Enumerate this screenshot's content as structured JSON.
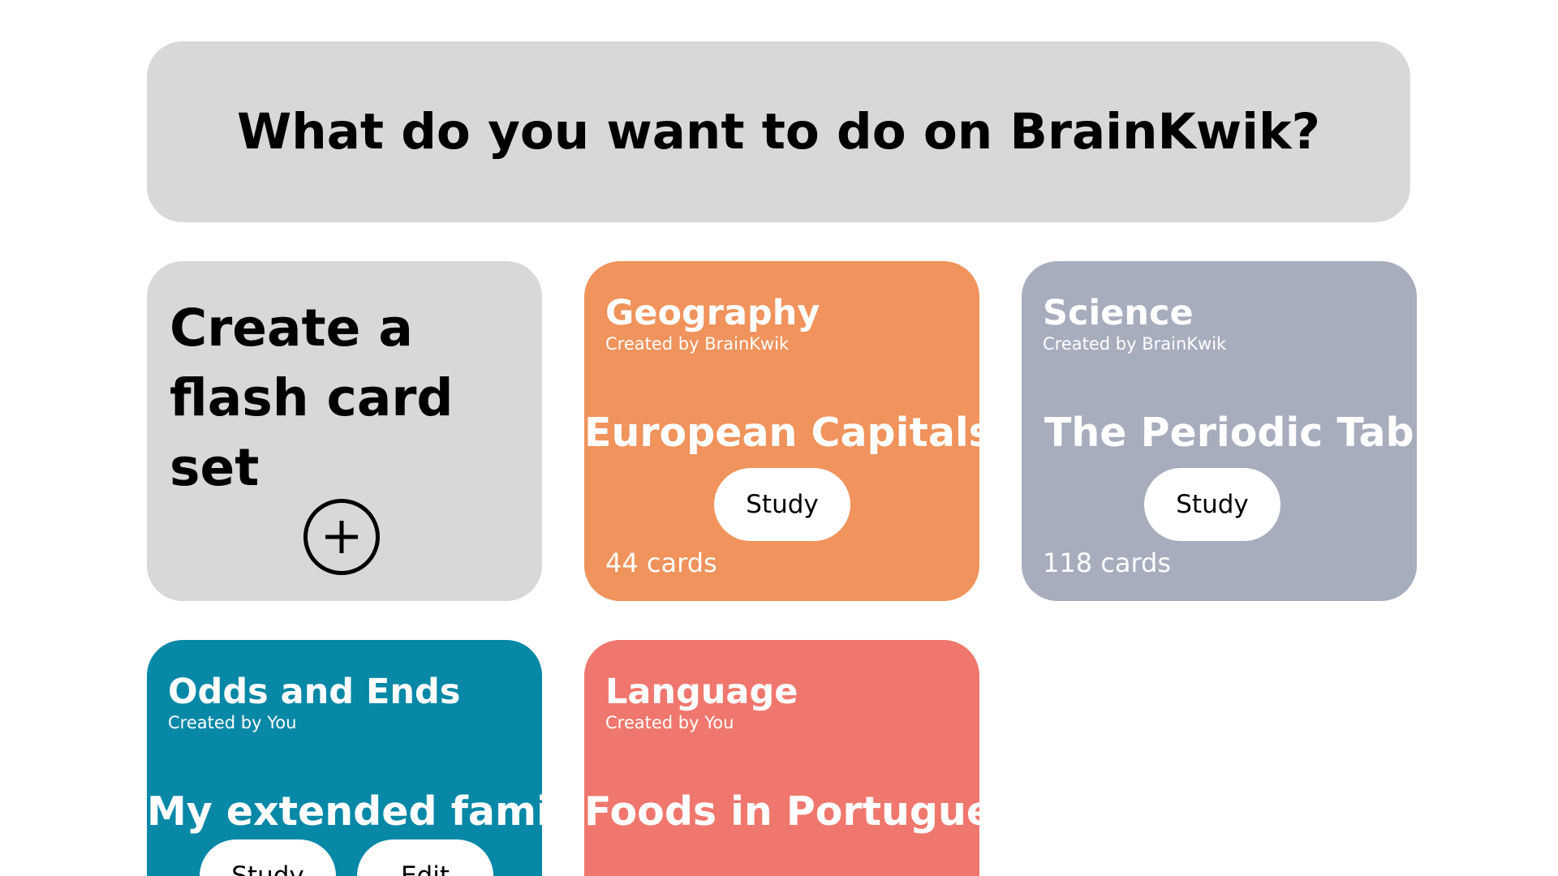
{
  "header": {
    "title": "What do you want to do on BrainKwik?"
  },
  "create_card": {
    "title": "Create a flash card set",
    "add_icon": "plus-circle-icon"
  },
  "cards": [
    {
      "category": "Geography",
      "creator": "Created by BrainKwik",
      "title": "European Capitals",
      "study_label": "Study",
      "count": "44 cards",
      "color": "#f0935c"
    },
    {
      "category": "Science",
      "creator": "Created by BrainKwik",
      "title": "The Periodic Table",
      "study_label": "Study",
      "count": "118 cards",
      "color": "#a7adbd"
    },
    {
      "category": "Odds and Ends",
      "creator": "Created by You",
      "title": "My extended family",
      "study_label": "Study",
      "edit_label": "Edit",
      "color": "#0788a7"
    },
    {
      "category": "Language",
      "creator": "Created by You",
      "title": "Foods in Portuguese",
      "color": "#f0776d"
    }
  ],
  "colors": {
    "header_bg": "#d8d7d9",
    "create_bg": "#d8d7d9",
    "button_bg": "#ffffff"
  }
}
